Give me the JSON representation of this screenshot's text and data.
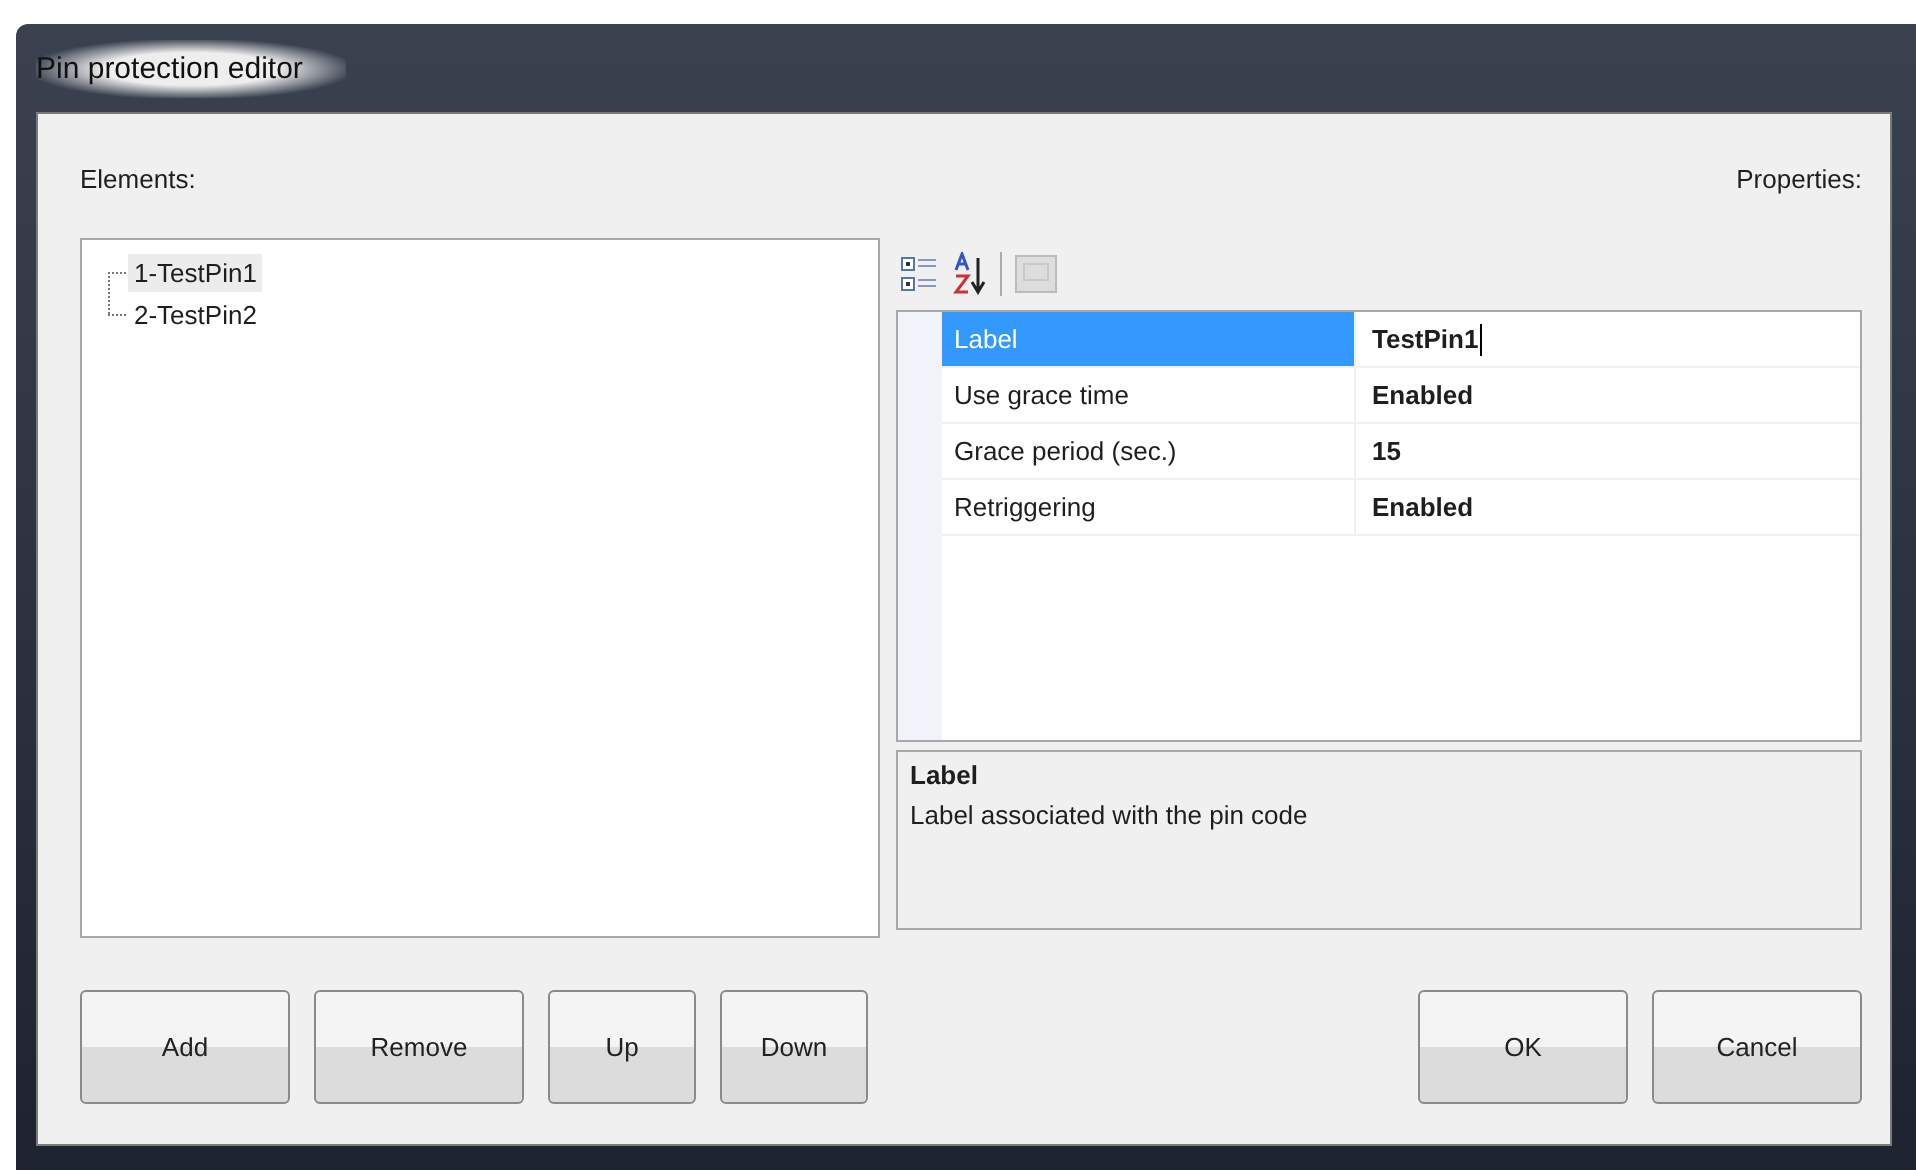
{
  "window": {
    "title": "Pin protection editor"
  },
  "elements_label": "Elements:",
  "properties_label": "Properties:",
  "tree": {
    "items": [
      {
        "label": "1-TestPin1",
        "selected": true
      },
      {
        "label": "2-TestPin2",
        "selected": false
      }
    ]
  },
  "properties": [
    {
      "name": "Label",
      "value": "TestPin1",
      "selected": true
    },
    {
      "name": "Use grace time",
      "value": "Enabled",
      "selected": false
    },
    {
      "name": "Grace period (sec.)",
      "value": "15",
      "selected": false
    },
    {
      "name": "Retriggering",
      "value": "Enabled",
      "selected": false
    }
  ],
  "description": {
    "title": "Label",
    "text": "Label associated with the pin code"
  },
  "left_buttons": [
    "Add",
    "Remove",
    "Up",
    "Down"
  ],
  "right_buttons": [
    "OK",
    "Cancel"
  ]
}
